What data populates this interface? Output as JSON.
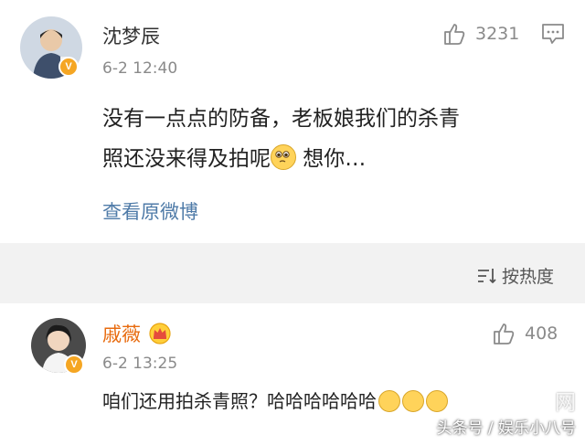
{
  "post": {
    "username": "沈梦辰",
    "time": "6-2 12:40",
    "like_count": "3231",
    "text_line1": "没有一点点的防备，老板娘我们的杀青",
    "text_line2_before": "照还没来得及拍呢",
    "text_line2_after": " 想你…",
    "view_original": "查看原微博",
    "verified_badge": "V"
  },
  "sort": {
    "label": "按热度"
  },
  "comment": {
    "username": "戚薇",
    "time": "6-2 13:25",
    "like_count": "408",
    "text": "咱们还用拍杀青照？哈哈哈哈哈哈",
    "verified_badge": "V"
  },
  "watermark": {
    "line1": "头条号 / 娱乐小八号",
    "partial_site_text": "网"
  },
  "icons": {
    "like": "thumbs-up-icon",
    "comment": "comment-icon",
    "sort": "sort-icon",
    "crown": "crown-icon",
    "emoji": "pleading-face-emoji"
  }
}
